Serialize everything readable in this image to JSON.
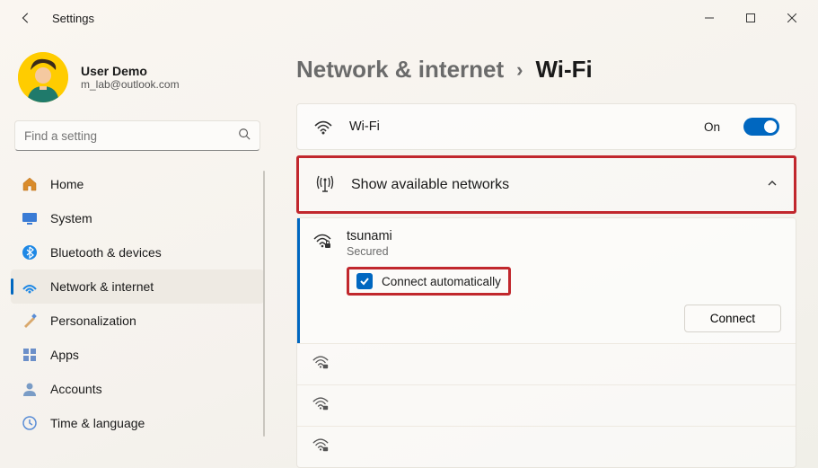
{
  "window": {
    "title": "Settings"
  },
  "user": {
    "name": "User Demo",
    "email": "m_lab@outlook.com"
  },
  "search": {
    "placeholder": "Find a setting"
  },
  "nav": {
    "items": [
      {
        "label": "Home"
      },
      {
        "label": "System"
      },
      {
        "label": "Bluetooth & devices"
      },
      {
        "label": "Network & internet"
      },
      {
        "label": "Personalization"
      },
      {
        "label": "Apps"
      },
      {
        "label": "Accounts"
      },
      {
        "label": "Time & language"
      }
    ]
  },
  "breadcrumb": {
    "parent": "Network & internet",
    "sep": "›",
    "current": "Wi-Fi"
  },
  "wifi_card": {
    "label": "Wi-Fi",
    "state_label": "On"
  },
  "networks_header": {
    "label": "Show available networks"
  },
  "network": {
    "name": "tsunami",
    "security": "Secured",
    "auto_label": "Connect automatically",
    "connect_btn": "Connect"
  }
}
